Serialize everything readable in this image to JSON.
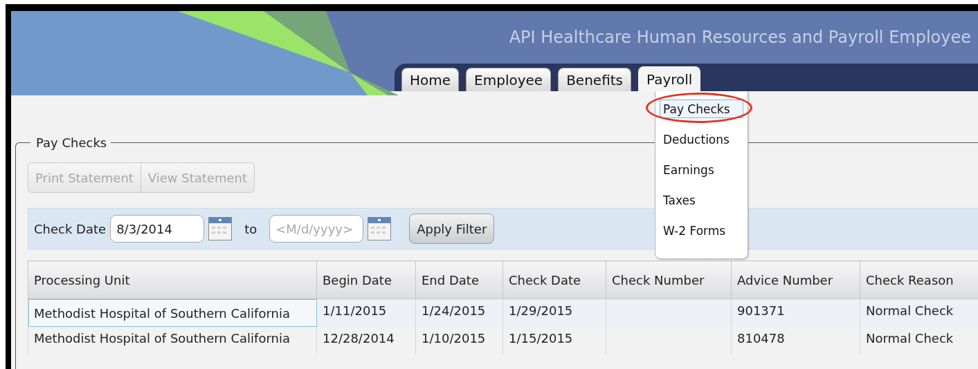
{
  "header": {
    "title": "API Healthcare Human Resources and Payroll Employee"
  },
  "tabs": [
    {
      "label": "Home",
      "selected": false
    },
    {
      "label": "Employee",
      "selected": false
    },
    {
      "label": "Benefits",
      "selected": false
    },
    {
      "label": "Payroll",
      "selected": true
    }
  ],
  "menu": {
    "items": [
      {
        "label": "Pay Checks",
        "selected": true,
        "circled": true
      },
      {
        "label": "Deductions",
        "selected": false,
        "circled": false
      },
      {
        "label": "Earnings",
        "selected": false,
        "circled": false
      },
      {
        "label": "Taxes",
        "selected": false,
        "circled": false
      },
      {
        "label": "W-2 Forms",
        "selected": false,
        "circled": false
      }
    ]
  },
  "panel": {
    "title": "Pay Checks",
    "buttons": [
      {
        "label": "Print Statement",
        "disabled": true
      },
      {
        "label": "View Statement",
        "disabled": true
      }
    ],
    "filter": {
      "label": "Check Date",
      "from": {
        "value": "8/3/2014"
      },
      "to_label": "to",
      "to": {
        "placeholder": "<M/d/yyyy>"
      },
      "apply": "Apply Filter"
    },
    "table": {
      "columns": [
        "Processing Unit",
        "Begin Date",
        "End Date",
        "Check Date",
        "Check Number",
        "Advice Number",
        "Check Reason"
      ],
      "rows": [
        {
          "selected": true,
          "cells": [
            "Methodist Hospital of Southern California",
            "1/11/2015",
            "1/24/2015",
            "1/29/2015",
            "",
            "901371",
            "Normal Check"
          ]
        },
        {
          "selected": false,
          "cells": [
            "Methodist Hospital of Southern California",
            "12/28/2014",
            "1/10/2015",
            "1/15/2015",
            "",
            "810478",
            "Normal Check"
          ]
        }
      ]
    }
  }
}
